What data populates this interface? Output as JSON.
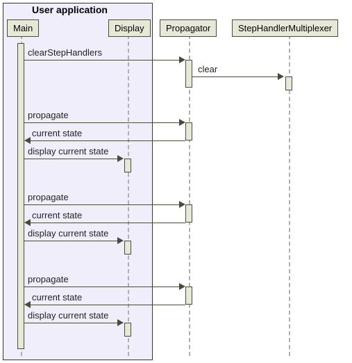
{
  "group": {
    "title": "User application"
  },
  "participants": {
    "main": "Main",
    "display": "Display",
    "propagator": "Propagator",
    "stephandler": "StepHandlerMultiplexer"
  },
  "messages": {
    "clearStepHandlers": "clearStepHandlers",
    "clear": "clear",
    "propagate1": "propagate",
    "currentState1": "current state",
    "displayCurrent1": "display current state",
    "propagate2": "propagate",
    "currentState2": "current state",
    "displayCurrent2": "display current state",
    "propagate3": "propagate",
    "currentState3": "current state",
    "displayCurrent3": "display current state"
  },
  "chart_data": {
    "type": "sequence-diagram",
    "group": {
      "name": "User application",
      "members": [
        "Main",
        "Display"
      ]
    },
    "participants": [
      "Main",
      "Display",
      "Propagator",
      "StepHandlerMultiplexer"
    ],
    "messages": [
      {
        "from": "Main",
        "to": "Propagator",
        "label": "clearStepHandlers",
        "type": "call"
      },
      {
        "from": "Propagator",
        "to": "StepHandlerMultiplexer",
        "label": "clear",
        "type": "call"
      },
      {
        "from": "Main",
        "to": "Propagator",
        "label": "propagate",
        "type": "call"
      },
      {
        "from": "Propagator",
        "to": "Main",
        "label": "current state",
        "type": "return"
      },
      {
        "from": "Main",
        "to": "Display",
        "label": "display current state",
        "type": "call"
      },
      {
        "from": "Main",
        "to": "Propagator",
        "label": "propagate",
        "type": "call"
      },
      {
        "from": "Propagator",
        "to": "Main",
        "label": "current state",
        "type": "return"
      },
      {
        "from": "Main",
        "to": "Display",
        "label": "display current state",
        "type": "call"
      },
      {
        "from": "Main",
        "to": "Propagator",
        "label": "propagate",
        "type": "call"
      },
      {
        "from": "Propagator",
        "to": "Main",
        "label": "current state",
        "type": "return"
      },
      {
        "from": "Main",
        "to": "Display",
        "label": "display current state",
        "type": "call"
      }
    ]
  }
}
